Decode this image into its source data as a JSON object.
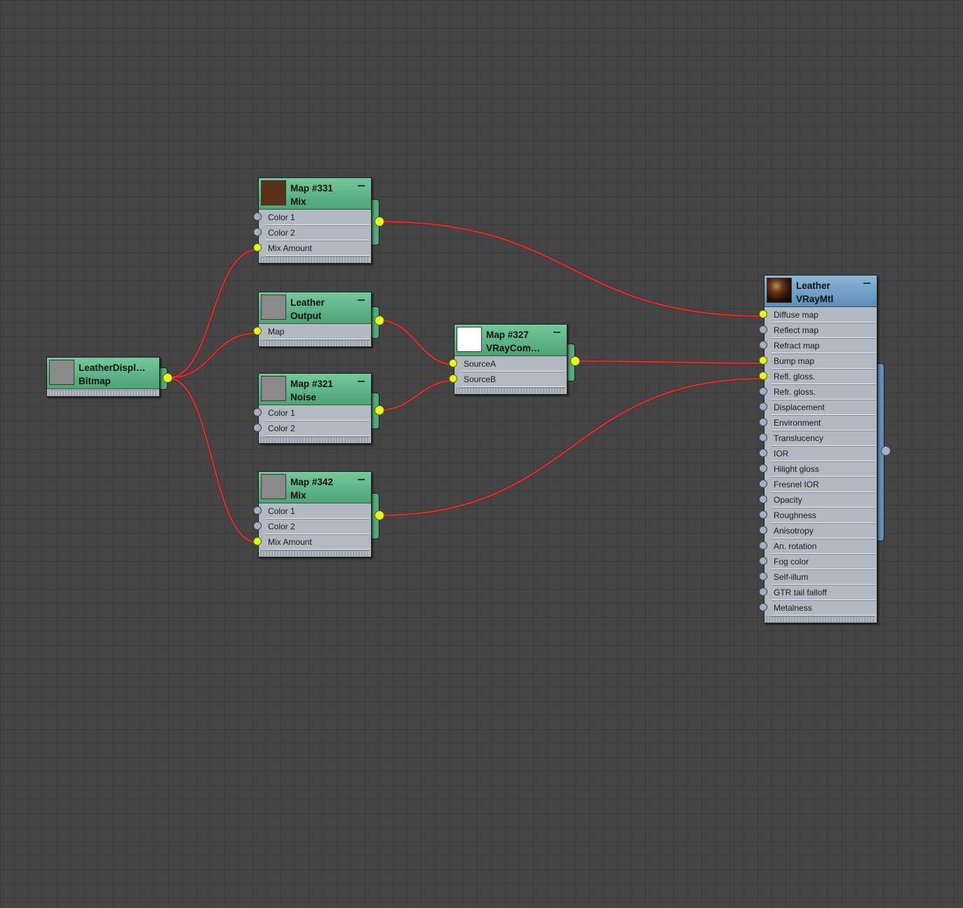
{
  "nodes": {
    "bitmap": {
      "name": "LeatherDispl…",
      "type": "Bitmap",
      "thumb_color": "#8a8a8a"
    },
    "mix331": {
      "name": "Map #331",
      "type": "Mix",
      "thumb_color": "#5b3018",
      "slots": [
        "Color 1",
        "Color 2",
        "Mix Amount"
      ]
    },
    "output": {
      "name": "Leather",
      "type": "Output",
      "thumb_color": "#8a8a8a",
      "slots": [
        "Map"
      ]
    },
    "noise321": {
      "name": "Map #321",
      "type": "Noise",
      "thumb_color": "#8a8a8a",
      "slots": [
        "Color 1",
        "Color 2"
      ]
    },
    "mix342": {
      "name": "Map #342",
      "type": "Mix",
      "thumb_color": "#8a8a8a",
      "slots": [
        "Color 1",
        "Color 2",
        "Mix Amount"
      ]
    },
    "comp327": {
      "name": "Map #327",
      "type": "VRayCom…",
      "thumb_color": "#ffffff",
      "slots": [
        "SourceA",
        "SourceB"
      ]
    },
    "leather": {
      "name": "Leather",
      "type": "VRayMtl",
      "thumb_icon": "sphere-preview",
      "slots": [
        "Diffuse map",
        "Reflect map",
        "Refract map",
        "Bump map",
        "Refl. gloss.",
        "Refr. gloss.",
        "Displacement",
        "Environment",
        "Translucency",
        "IOR",
        "Hilight gloss",
        "Fresnel IOR",
        "Opacity",
        "Roughness",
        "Anisotropy",
        "An. rotation",
        "Fog color",
        "Self-illum",
        "GTR tail falloff",
        "Metalness"
      ]
    }
  },
  "colors": {
    "map_header": "#5fb486",
    "material_header": "#7aa3c9",
    "connected_port": "#e4ff14",
    "wire": "#e81e1e"
  }
}
